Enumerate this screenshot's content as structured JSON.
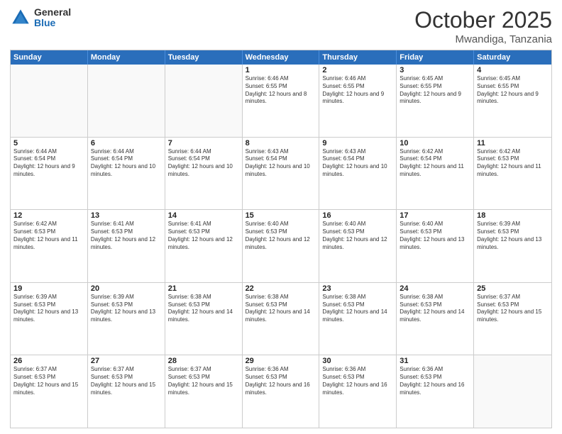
{
  "logo": {
    "general": "General",
    "blue": "Blue"
  },
  "header": {
    "month": "October 2025",
    "location": "Mwandiga, Tanzania"
  },
  "weekdays": [
    "Sunday",
    "Monday",
    "Tuesday",
    "Wednesday",
    "Thursday",
    "Friday",
    "Saturday"
  ],
  "rows": [
    [
      {
        "day": "",
        "info": "",
        "empty": true
      },
      {
        "day": "",
        "info": "",
        "empty": true
      },
      {
        "day": "",
        "info": "",
        "empty": true
      },
      {
        "day": "1",
        "info": "Sunrise: 6:46 AM\nSunset: 6:55 PM\nDaylight: 12 hours and 8 minutes."
      },
      {
        "day": "2",
        "info": "Sunrise: 6:46 AM\nSunset: 6:55 PM\nDaylight: 12 hours and 9 minutes."
      },
      {
        "day": "3",
        "info": "Sunrise: 6:45 AM\nSunset: 6:55 PM\nDaylight: 12 hours and 9 minutes."
      },
      {
        "day": "4",
        "info": "Sunrise: 6:45 AM\nSunset: 6:55 PM\nDaylight: 12 hours and 9 minutes."
      }
    ],
    [
      {
        "day": "5",
        "info": "Sunrise: 6:44 AM\nSunset: 6:54 PM\nDaylight: 12 hours and 9 minutes."
      },
      {
        "day": "6",
        "info": "Sunrise: 6:44 AM\nSunset: 6:54 PM\nDaylight: 12 hours and 10 minutes."
      },
      {
        "day": "7",
        "info": "Sunrise: 6:44 AM\nSunset: 6:54 PM\nDaylight: 12 hours and 10 minutes."
      },
      {
        "day": "8",
        "info": "Sunrise: 6:43 AM\nSunset: 6:54 PM\nDaylight: 12 hours and 10 minutes."
      },
      {
        "day": "9",
        "info": "Sunrise: 6:43 AM\nSunset: 6:54 PM\nDaylight: 12 hours and 10 minutes."
      },
      {
        "day": "10",
        "info": "Sunrise: 6:42 AM\nSunset: 6:54 PM\nDaylight: 12 hours and 11 minutes."
      },
      {
        "day": "11",
        "info": "Sunrise: 6:42 AM\nSunset: 6:53 PM\nDaylight: 12 hours and 11 minutes."
      }
    ],
    [
      {
        "day": "12",
        "info": "Sunrise: 6:42 AM\nSunset: 6:53 PM\nDaylight: 12 hours and 11 minutes."
      },
      {
        "day": "13",
        "info": "Sunrise: 6:41 AM\nSunset: 6:53 PM\nDaylight: 12 hours and 12 minutes."
      },
      {
        "day": "14",
        "info": "Sunrise: 6:41 AM\nSunset: 6:53 PM\nDaylight: 12 hours and 12 minutes."
      },
      {
        "day": "15",
        "info": "Sunrise: 6:40 AM\nSunset: 6:53 PM\nDaylight: 12 hours and 12 minutes."
      },
      {
        "day": "16",
        "info": "Sunrise: 6:40 AM\nSunset: 6:53 PM\nDaylight: 12 hours and 12 minutes."
      },
      {
        "day": "17",
        "info": "Sunrise: 6:40 AM\nSunset: 6:53 PM\nDaylight: 12 hours and 13 minutes."
      },
      {
        "day": "18",
        "info": "Sunrise: 6:39 AM\nSunset: 6:53 PM\nDaylight: 12 hours and 13 minutes."
      }
    ],
    [
      {
        "day": "19",
        "info": "Sunrise: 6:39 AM\nSunset: 6:53 PM\nDaylight: 12 hours and 13 minutes."
      },
      {
        "day": "20",
        "info": "Sunrise: 6:39 AM\nSunset: 6:53 PM\nDaylight: 12 hours and 13 minutes."
      },
      {
        "day": "21",
        "info": "Sunrise: 6:38 AM\nSunset: 6:53 PM\nDaylight: 12 hours and 14 minutes."
      },
      {
        "day": "22",
        "info": "Sunrise: 6:38 AM\nSunset: 6:53 PM\nDaylight: 12 hours and 14 minutes."
      },
      {
        "day": "23",
        "info": "Sunrise: 6:38 AM\nSunset: 6:53 PM\nDaylight: 12 hours and 14 minutes."
      },
      {
        "day": "24",
        "info": "Sunrise: 6:38 AM\nSunset: 6:53 PM\nDaylight: 12 hours and 14 minutes."
      },
      {
        "day": "25",
        "info": "Sunrise: 6:37 AM\nSunset: 6:53 PM\nDaylight: 12 hours and 15 minutes."
      }
    ],
    [
      {
        "day": "26",
        "info": "Sunrise: 6:37 AM\nSunset: 6:53 PM\nDaylight: 12 hours and 15 minutes."
      },
      {
        "day": "27",
        "info": "Sunrise: 6:37 AM\nSunset: 6:53 PM\nDaylight: 12 hours and 15 minutes."
      },
      {
        "day": "28",
        "info": "Sunrise: 6:37 AM\nSunset: 6:53 PM\nDaylight: 12 hours and 15 minutes."
      },
      {
        "day": "29",
        "info": "Sunrise: 6:36 AM\nSunset: 6:53 PM\nDaylight: 12 hours and 16 minutes."
      },
      {
        "day": "30",
        "info": "Sunrise: 6:36 AM\nSunset: 6:53 PM\nDaylight: 12 hours and 16 minutes."
      },
      {
        "day": "31",
        "info": "Sunrise: 6:36 AM\nSunset: 6:53 PM\nDaylight: 12 hours and 16 minutes."
      },
      {
        "day": "",
        "info": "",
        "empty": true
      }
    ]
  ]
}
